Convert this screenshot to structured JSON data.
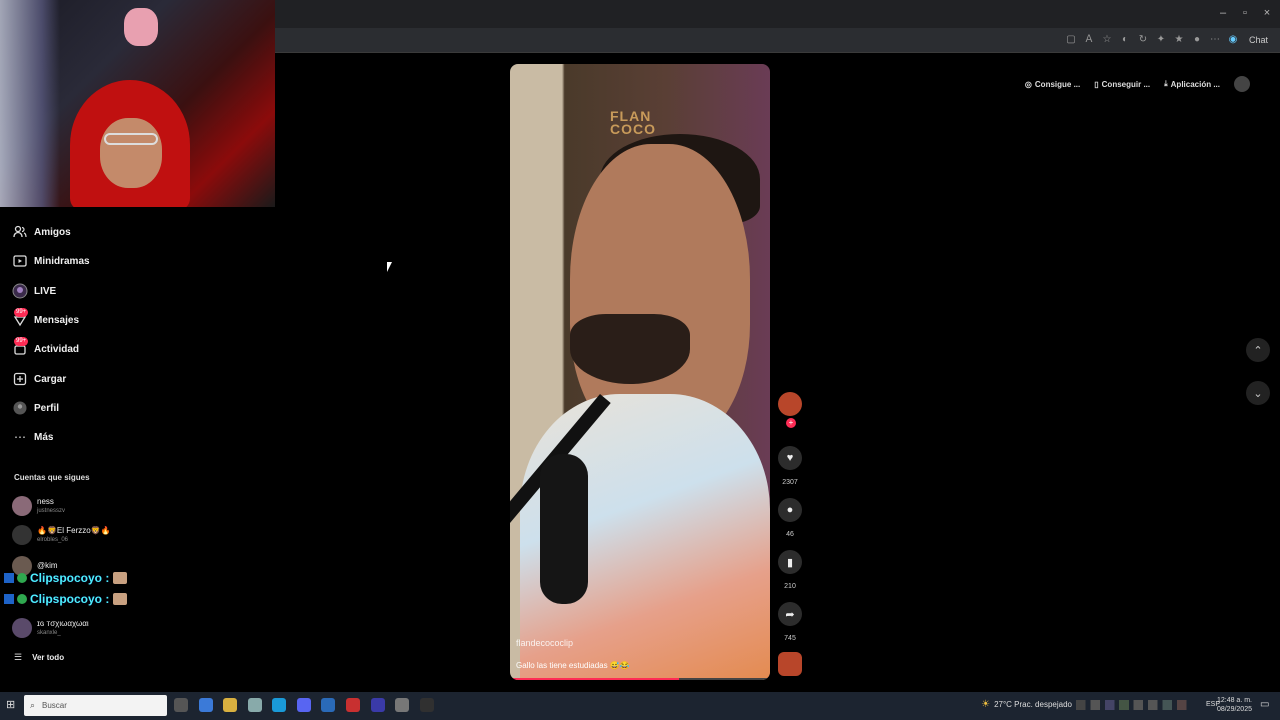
{
  "window": {
    "minimize": "–",
    "maximize": "▫",
    "close": "×"
  },
  "browser": {
    "chat_label": "Chat"
  },
  "sidebar": {
    "items": [
      {
        "label": "Amigos",
        "icon": "friends-icon"
      },
      {
        "label": "Minidramas",
        "icon": "minidramas-icon"
      },
      {
        "label": "LIVE",
        "icon": "live-icon"
      },
      {
        "label": "Mensajes",
        "icon": "messages-icon",
        "badge": "99+"
      },
      {
        "label": "Actividad",
        "icon": "activity-icon",
        "badge": "99+"
      },
      {
        "label": "Cargar",
        "icon": "upload-icon"
      },
      {
        "label": "Perfil",
        "icon": "profile-icon"
      },
      {
        "label": "Más",
        "icon": "more-icon"
      }
    ],
    "following_title": "Cuentas que sigues",
    "following": [
      {
        "name": "ness",
        "handle": "justnesszv"
      },
      {
        "name": "🔥🦁El Ferzzo🦁🔥",
        "handle": "elrobles_06"
      },
      {
        "name": "@kim",
        "handle": ""
      },
      {
        "name": "ɪɢ тσχιωαχωαι",
        "handle": "skanxle_"
      }
    ],
    "see_all": "Ver todo"
  },
  "stream_chat": [
    {
      "name": "Clipspocoyo :"
    },
    {
      "name": "Clipspocoyo :"
    }
  ],
  "video": {
    "logo_line1": "FLAN",
    "logo_line2": "COCO",
    "author": "flandecococlip",
    "caption": "Gallo las tiene estudiadas 😅😂",
    "progress": 0.65
  },
  "actions": {
    "likes": "2307",
    "comments": "46",
    "saves": "210",
    "shares": "745"
  },
  "top_right": {
    "item1": "Consigue ...",
    "item2": "Conseguir ...",
    "item3": "Aplicación ..."
  },
  "nav": {
    "up": "⌃",
    "down": "⌄"
  },
  "taskbar": {
    "search_placeholder": "Buscar",
    "weather": "27°C  Prac. despejado",
    "lang": "ESP",
    "time": "12:48 a. m.",
    "date": "08/29/2025"
  }
}
